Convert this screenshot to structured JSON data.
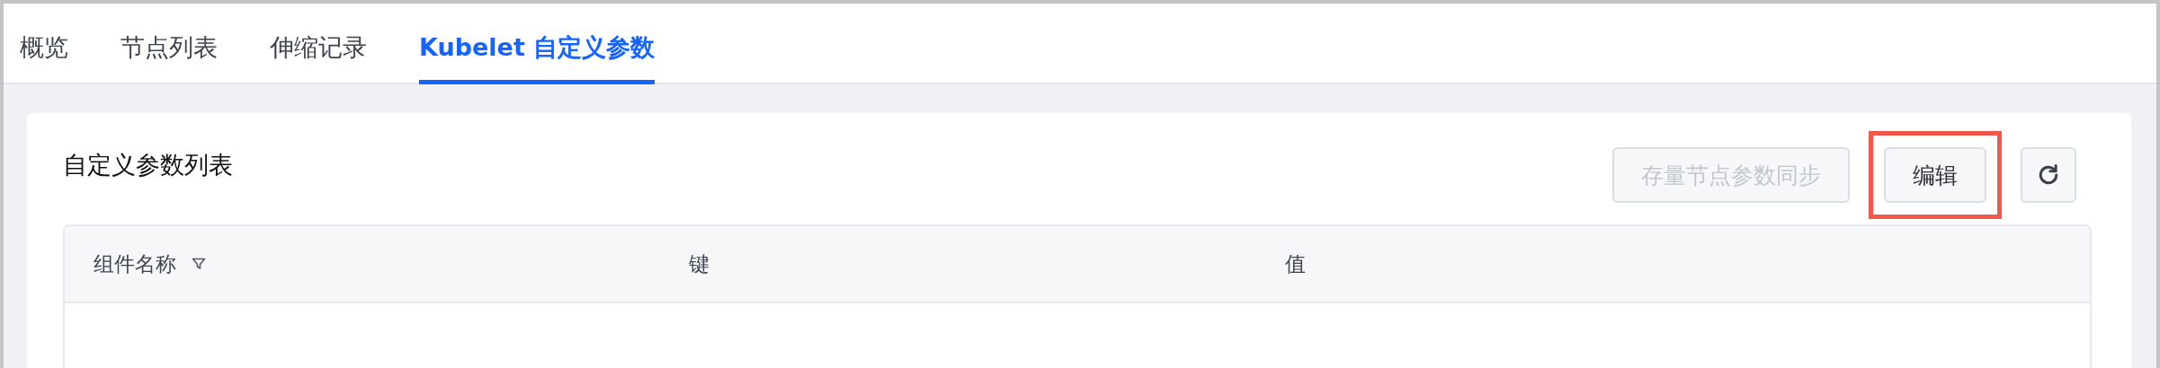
{
  "tabs": [
    {
      "label": "概览",
      "selected": false
    },
    {
      "label": "节点列表",
      "selected": false
    },
    {
      "label": "伸缩记录",
      "selected": false
    },
    {
      "label": "Kubelet 自定义参数",
      "selected": true
    }
  ],
  "card": {
    "title": "自定义参数列表",
    "buttons": [
      {
        "kind": "text",
        "label": "存量节点参数同步",
        "disabled": true,
        "highlighted": false
      },
      {
        "kind": "text",
        "label": "编辑",
        "disabled": false,
        "highlighted": true
      },
      {
        "kind": "refresh"
      }
    ]
  },
  "table": {
    "columns": [
      {
        "label": "组件名称",
        "filter": true
      },
      {
        "label": "键",
        "filter": false
      },
      {
        "label": "值",
        "filter": false
      }
    ]
  }
}
